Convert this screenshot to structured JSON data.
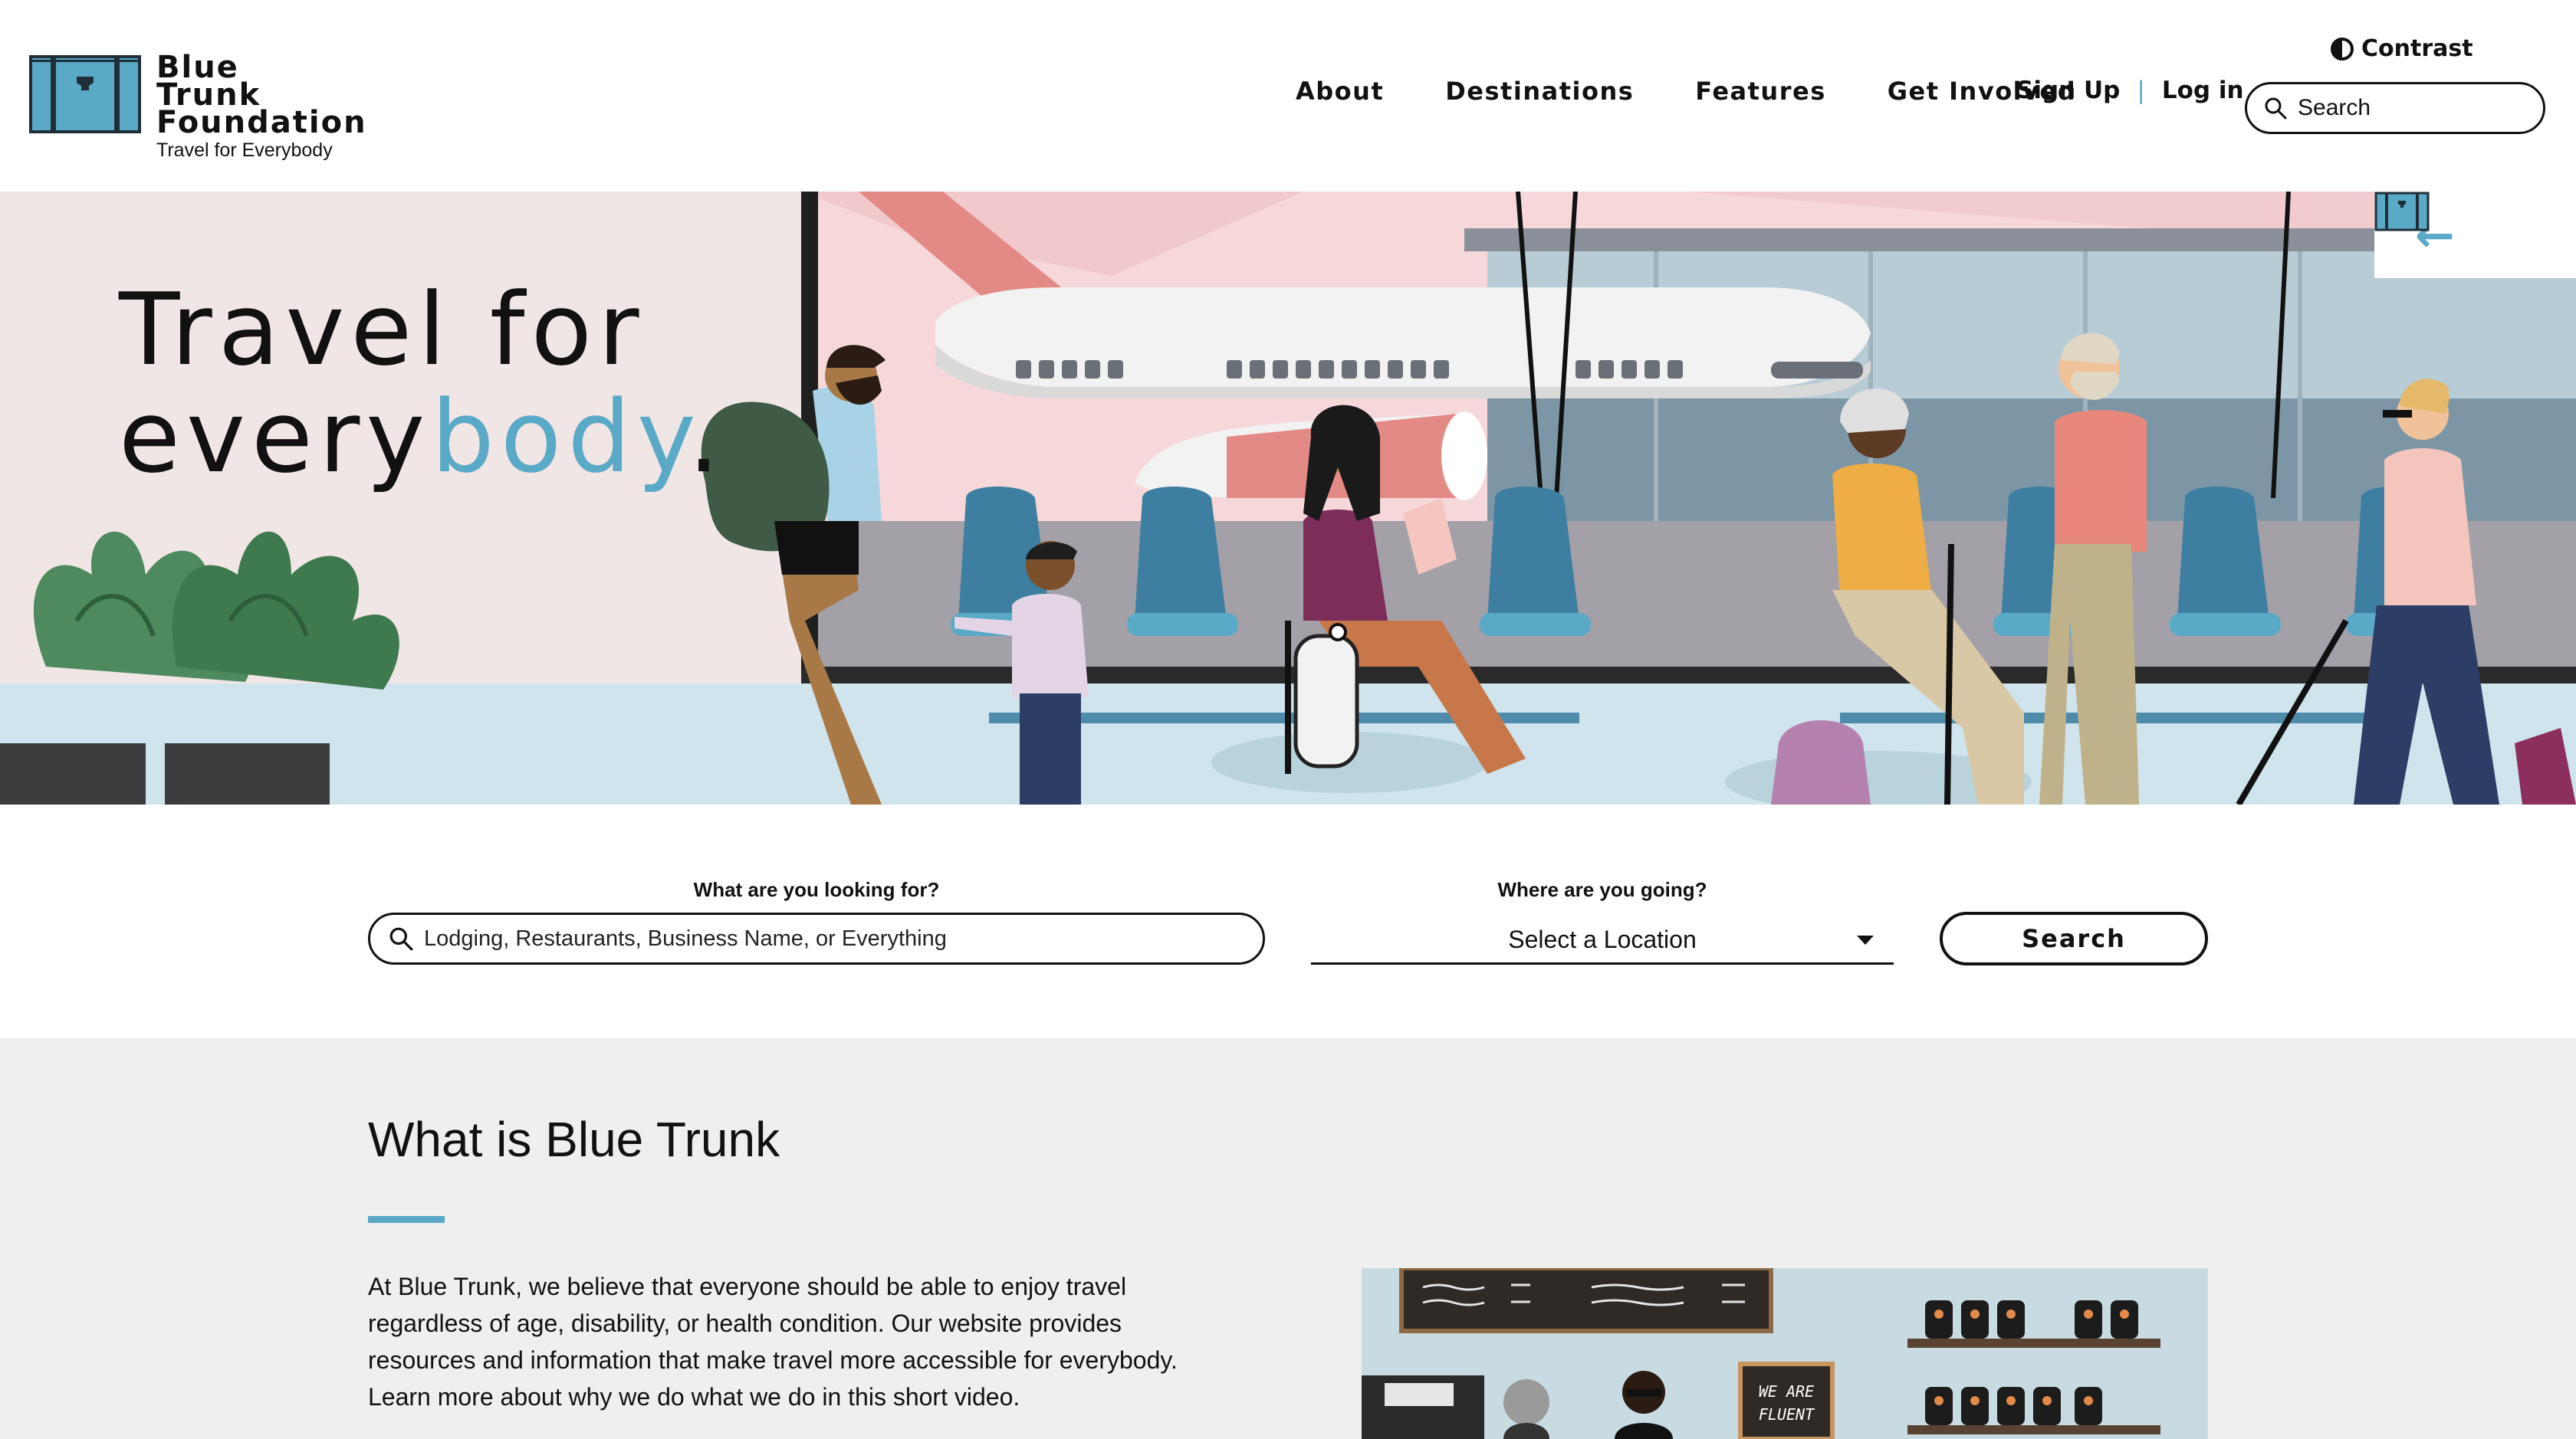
{
  "header": {
    "logo": {
      "name": "Blue Trunk Foundation",
      "tagline": "Travel for Everybody"
    },
    "nav": [
      {
        "label": "About"
      },
      {
        "label": "Destinations"
      },
      {
        "label": "Features"
      },
      {
        "label": "Get Involved"
      }
    ],
    "auth": {
      "sign_up": "Sign Up",
      "separator": "|",
      "log_in": "Log in"
    },
    "contrast_label": "Contrast",
    "search_placeholder": "Search"
  },
  "hero": {
    "title_line1": "Travel for",
    "title_line2_prefix": "every",
    "title_line2_accent": "body",
    "title_line2_suffix": ".",
    "illustration_icon": "airport-waiting-area-illustration",
    "carousel": {
      "prev_icon": "arrow-left-icon",
      "logo_icon": "trunk-icon"
    }
  },
  "search": {
    "what_label": "What are you looking for?",
    "what_placeholder": "Lodging, Restaurants, Business Name, or Everything",
    "where_label": "Where are you going?",
    "where_value": "Select a Location",
    "button_label": "Search"
  },
  "about": {
    "title": "What is Blue Trunk",
    "body": "At Blue Trunk, we believe that everyone should be able to enjoy travel regardless of age, disability, or health condition. Our website provides resources and information that make travel more accessible for everybody. Learn more about why we do what we do in this short video.",
    "video_sign_text": "WE ARE FLUENT",
    "video_thumbnail_icon": "cafe-illustration"
  },
  "colors": {
    "accent": "#5aa9c6",
    "text": "#111111",
    "hero_pink": "#f4d9da",
    "about_bg": "#efefef"
  }
}
